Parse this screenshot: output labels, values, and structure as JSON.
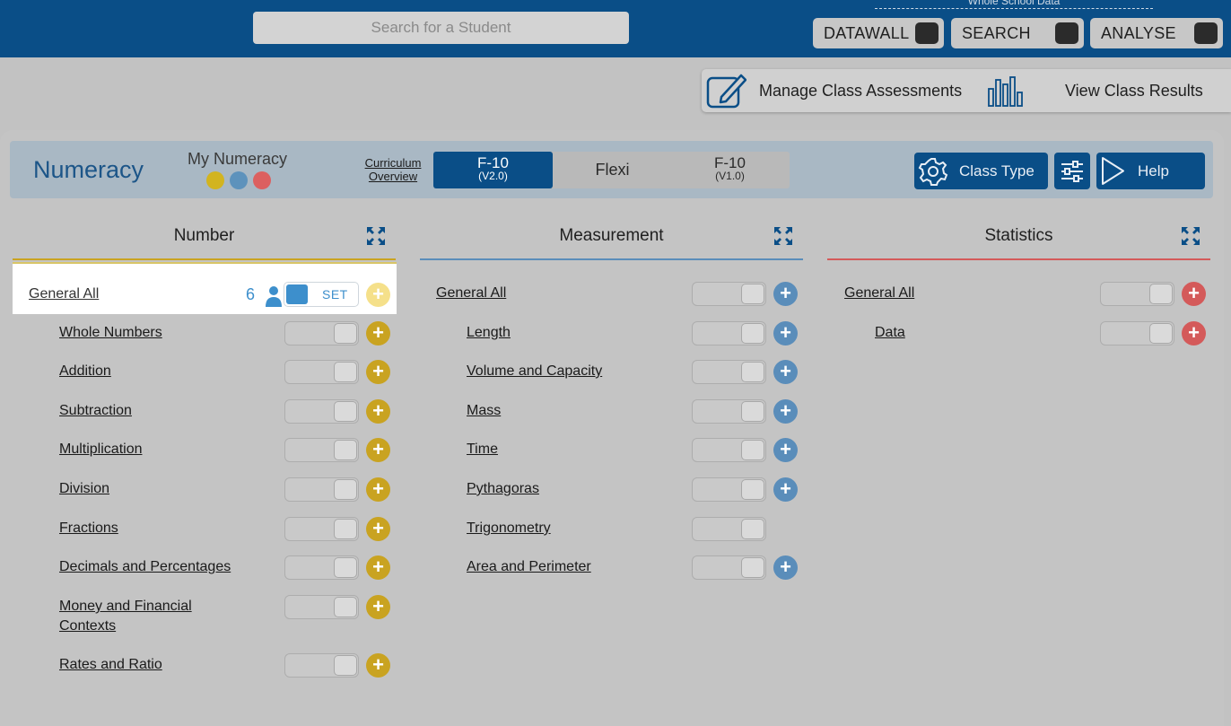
{
  "topbar": {
    "search_placeholder": "Search for a Student",
    "whole_school_label": "Whole School Data",
    "buttons": [
      {
        "label": "DATAWALL"
      },
      {
        "label": "SEARCH"
      },
      {
        "label": "ANALYSE"
      }
    ]
  },
  "assessbar": {
    "manage_label": "Manage Class Assessments",
    "results_label": "View Class Results"
  },
  "header": {
    "subject_title": "Numeracy",
    "my_label": "My Numeracy",
    "dots": [
      "#d2b420",
      "#5d92bc",
      "#dc6060"
    ],
    "curriculum_line1": "Curriculum",
    "curriculum_line2": "Overview",
    "segments": [
      {
        "main": "F-10",
        "sub": "(V2.0)",
        "active": true
      },
      {
        "main": "Flexi",
        "sub": ""
      },
      {
        "main": "F-10",
        "sub": "(V1.0)"
      }
    ],
    "class_type_label": "Class Type",
    "help_label": "Help"
  },
  "colors": {
    "primary": "#0a4e87",
    "number": "#c9a321",
    "measurement": "#5a8dba",
    "statistics": "#d45a5a"
  },
  "columns": {
    "number": {
      "title": "Number",
      "highlight": {
        "label": "General All",
        "count": "6",
        "set_label": "SET"
      },
      "items": [
        "Whole Numbers",
        "Addition",
        "Subtraction",
        "Multiplication",
        "Division",
        "Fractions",
        "Decimals and Percentages",
        "Money and Financial Contexts",
        "Rates and Ratio"
      ]
    },
    "measurement": {
      "title": "Measurement",
      "general": "General All",
      "items": [
        "Length",
        "Volume and Capacity",
        "Mass",
        "Time",
        "Pythagoras",
        "Trigonometry",
        "Area and Perimeter"
      ]
    },
    "statistics": {
      "title": "Statistics",
      "general": "General All",
      "items": [
        "Data"
      ]
    }
  }
}
